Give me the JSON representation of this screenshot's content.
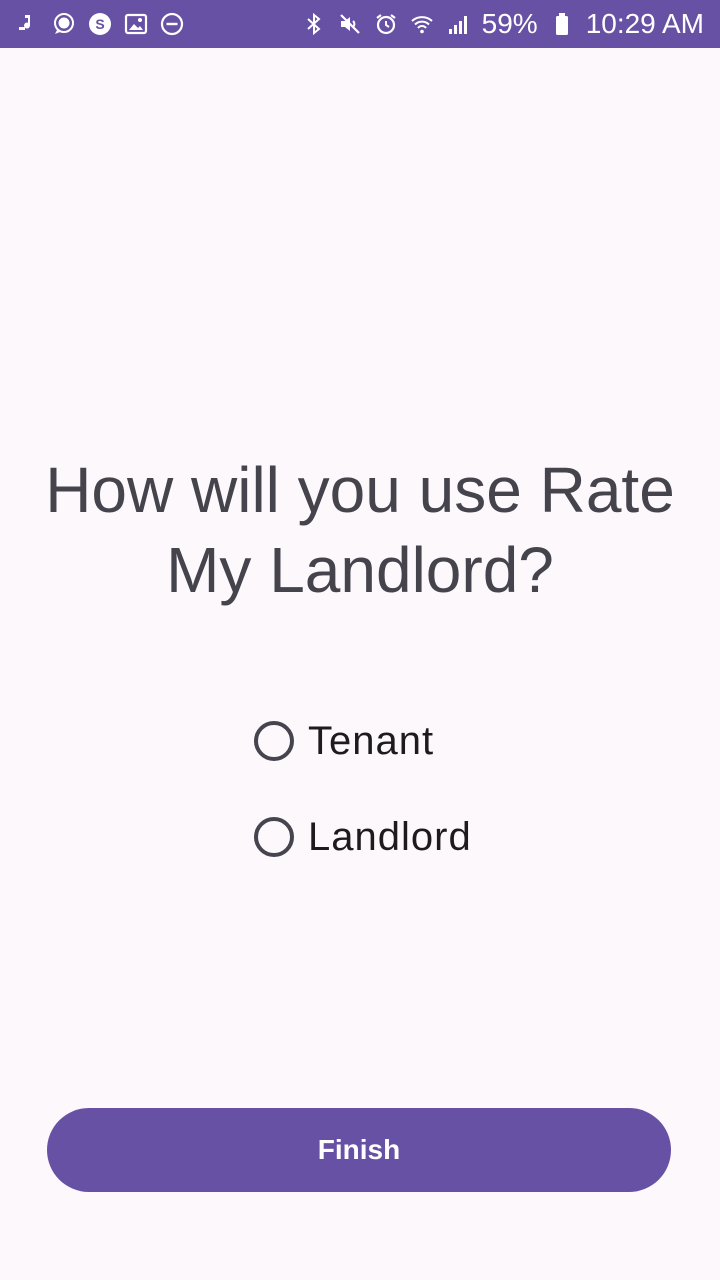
{
  "status_bar": {
    "battery_percent": "59%",
    "time": "10:29 AM",
    "left_icons": [
      "music-notification-icon",
      "chat-bubble-icon",
      "skype-icon",
      "image-icon",
      "do-not-disturb-icon"
    ],
    "right_icons": [
      "bluetooth-icon",
      "mute-icon",
      "alarm-icon",
      "wifi-icon",
      "signal-icon",
      "battery-icon"
    ]
  },
  "main": {
    "question": "How will you use Rate My Landlord?",
    "options": [
      {
        "label": "Tenant",
        "selected": false
      },
      {
        "label": "Landlord",
        "selected": false
      }
    ],
    "finish_label": "Finish"
  },
  "colors": {
    "primary": "#6751a4",
    "background": "#fdf8fc",
    "question_text": "#45434c",
    "option_text": "#1d1b20",
    "radio_border": "#46444f"
  }
}
